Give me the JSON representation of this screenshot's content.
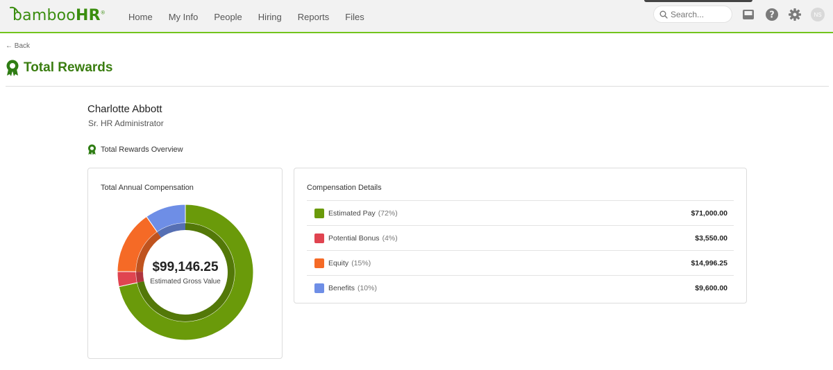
{
  "app": {
    "logo_text_light": "bamboo",
    "logo_text_bold": "HR",
    "logo_reg": "®"
  },
  "nav": {
    "items": [
      "Home",
      "My Info",
      "People",
      "Hiring",
      "Reports",
      "Files"
    ]
  },
  "search": {
    "placeholder": "Search..."
  },
  "user": {
    "initials": "NS"
  },
  "page": {
    "back_label": "← Back",
    "title": "Total Rewards"
  },
  "employee": {
    "name": "Charlotte Abbott",
    "job_title": "Sr. HR Administrator"
  },
  "section": {
    "overview_title": "Total Rewards Overview"
  },
  "compensation_card": {
    "title": "Total Annual Compensation",
    "center_value": "$99,146.25",
    "center_label": "Estimated Gross Value"
  },
  "details_card": {
    "title": "Compensation Details",
    "rows": [
      {
        "label": "Estimated Pay",
        "pct": "(72%)",
        "amount": "$71,000.00",
        "color": "#6a9a0a"
      },
      {
        "label": "Potential Bonus",
        "pct": "(4%)",
        "amount": "$3,550.00",
        "color": "#e04450"
      },
      {
        "label": "Equity",
        "pct": "(15%)",
        "amount": "$14,996.25",
        "color": "#f56a26"
      },
      {
        "label": "Benefits",
        "pct": "(10%)",
        "amount": "$9,600.00",
        "color": "#6e8ee6"
      }
    ]
  },
  "colors": {
    "accent": "#73c41d",
    "title_green": "#3a7d10"
  },
  "chart_data": {
    "type": "pie",
    "categories": [
      "Estimated Pay",
      "Potential Bonus",
      "Equity",
      "Benefits"
    ],
    "values": [
      71000.0,
      3550.0,
      14996.25,
      9600.0
    ],
    "colors": [
      "#6a9a0a",
      "#e04450",
      "#f56a26",
      "#6e8ee6"
    ],
    "style": "donut"
  }
}
